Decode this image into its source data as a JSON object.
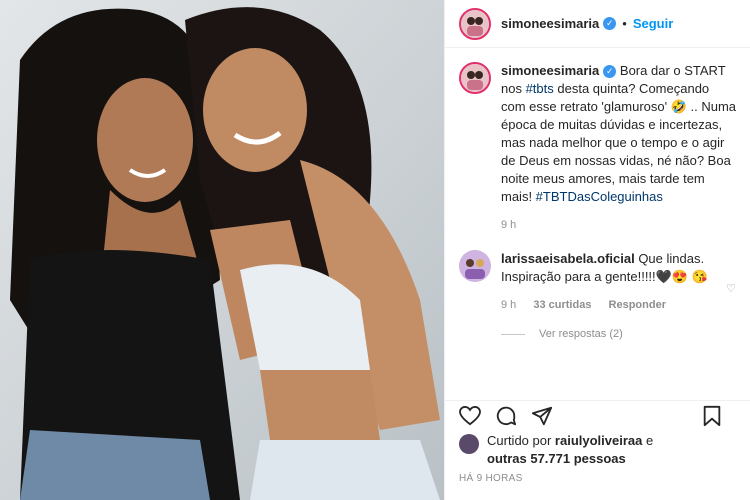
{
  "post": {
    "author": "simoneesimaria",
    "follow_label": "Seguir",
    "separator": "•"
  },
  "caption": {
    "username": "simoneesimaria",
    "text_before_tags": "Bora dar o START nos ",
    "hashtag1": "#tbts",
    "text_mid": " desta quinta? Começando com esse retrato 'glamuroso' 🤣 .. Numa época de muitas dúvidas e incertezas, mas nada melhor que o tempo e o agir de Deus em nossas vidas, né não? Boa noite meus amores, mais tarde tem mais! ",
    "hashtag2": "#TBTDasColeguinhas",
    "time": "9 h"
  },
  "comment": {
    "username": "larissaeisabela.oficial",
    "text": " Que lindas. Inspiração para a gente!!!!!🖤😍 😘",
    "time": "9 h",
    "likes": "33 curtidas",
    "reply_label": "Responder",
    "view_replies": "Ver respostas (2)"
  },
  "likes": {
    "prefix": "Curtido por ",
    "user": "raiulyoliveiraa",
    "suffix": " e",
    "others": "outras 57.771 pessoas"
  },
  "timestamp": "HÁ 9 HORAS",
  "icons": [
    "heart-icon",
    "comment-icon",
    "share-icon",
    "bookmark-icon"
  ],
  "colors": {
    "accent": "#0095f6",
    "verified": "#3897f0",
    "muted": "#8e8e8e"
  }
}
